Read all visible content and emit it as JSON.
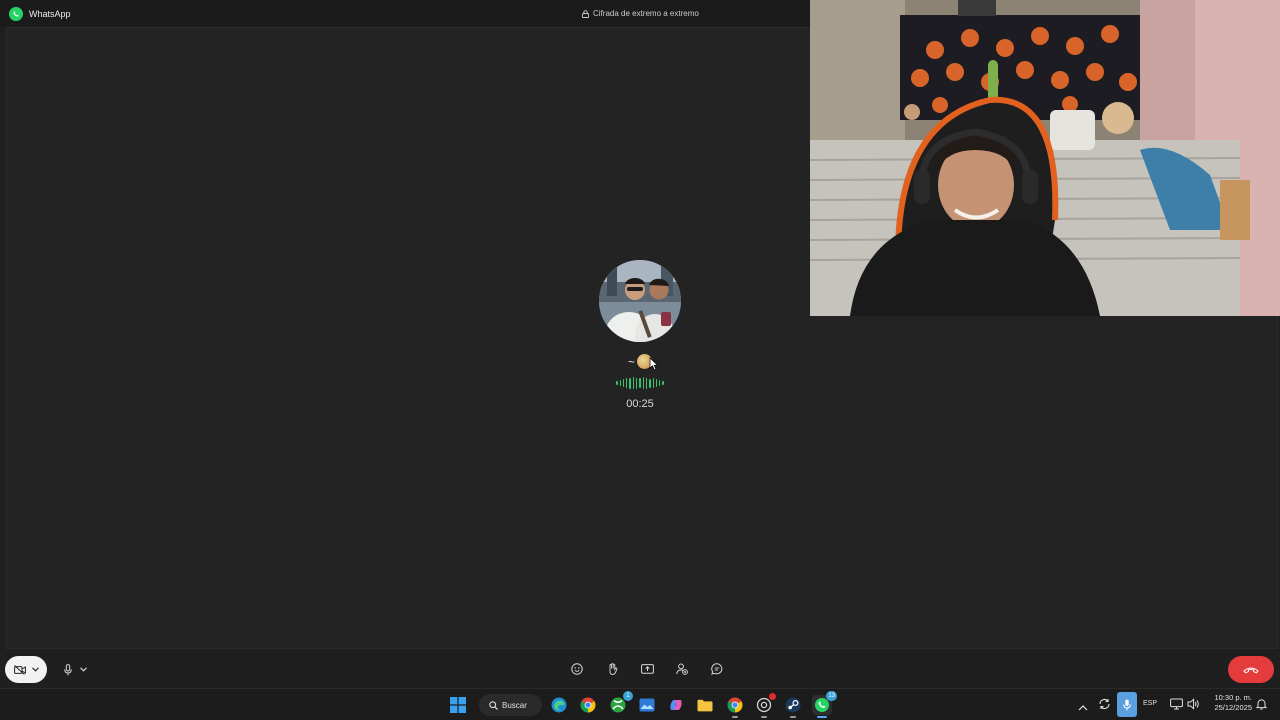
{
  "window": {
    "app_name": "WhatsApp",
    "encryption_label": "Cifrada de extremo a extremo"
  },
  "call": {
    "caller_prefix": "~",
    "timer": "00:25"
  },
  "taskbar": {
    "search_label": "Buscar",
    "xbox_badge": "1",
    "whatsapp_badge": "13"
  },
  "tray": {
    "language": "ESP",
    "time": "10:30 p. m.",
    "date": "25/12/2025"
  },
  "colors": {
    "accent_green": "#25d366",
    "voice_wave": "#3bc26b",
    "end_call": "#e43c3c",
    "mic_active": "#5a9fe0"
  }
}
